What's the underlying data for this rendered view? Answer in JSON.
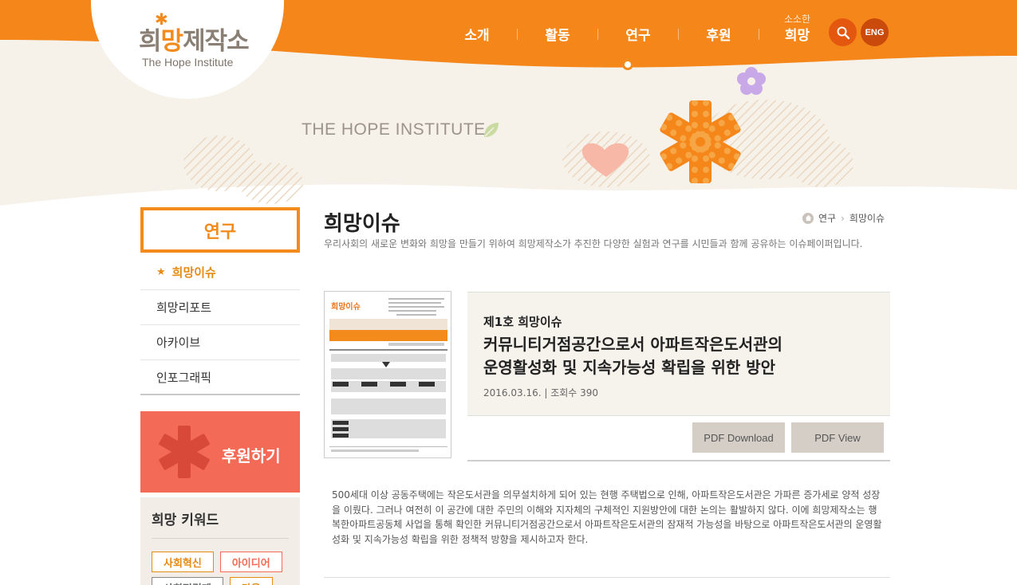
{
  "site": {
    "logo_text": "희망제작소",
    "logo_sub": "The Hope Institute",
    "tagline": "THE HOPE INSTITUTE"
  },
  "gnb": {
    "items": [
      "소개",
      "활동",
      "연구",
      "후원"
    ],
    "last_small": "소소한",
    "last_label": "희망",
    "eng": "ENG"
  },
  "sidebar": {
    "title": "연구",
    "active_marker": "★",
    "items": [
      "희망이슈",
      "희망리포트",
      "아카이브",
      "인포그래픽"
    ],
    "donate_label": "후원하기",
    "keywords_title": "희망 키워드",
    "keywords": [
      "사회혁신",
      "아이디어",
      "사회적경제",
      "마을"
    ]
  },
  "page": {
    "title": "희망이슈",
    "breadcrumb": [
      "연구",
      "희망이슈"
    ],
    "description": "우리사회의 새로운 변화와 희망을 만들기 위하여 희망제작소가 추진한 다양한 실험과 연구를 시민들과 함께 공유하는 이슈페이퍼입니다."
  },
  "issue": {
    "number": "제1호 희망이슈",
    "title_line1": "커뮤니티거점공간으로서 아파트작은도서관의",
    "title_line2": "운영활성화 및 지속가능성 확립을 위한 방안",
    "meta": "2016.03.16.  |  조회수 390",
    "pdf_download": "PDF Download",
    "pdf_view": "PDF View",
    "thumb_logo": "희망이슈",
    "body": "500세대 이상 공동주택에는 작은도서관을 의무설치하게 되어 있는 현행 주택법으로 인해, 아파트작은도서관은 가파른 증가세로 양적 성장을 이뤘다. 그러나 여전히 이 공간에 대한 주민의 이해와 지자체의 구체적인 지원방안에 대한 논의는 활발하지 않다. 이에 희망제작소는 행복한아파트공동체 사업을 통해 확인한 커뮤니티거점공간으로서 아파트작은도서관의 잠재적 가능성을 바탕으로 아파트작은도서관의 운영활성화 및 지속가능성 확립을 위한 정책적 방향을 제시하고자 한다."
  },
  "colors": {
    "brand_orange": "#f28a1c",
    "donate_coral": "#f36b56",
    "info_bg": "#f6f2ec"
  }
}
